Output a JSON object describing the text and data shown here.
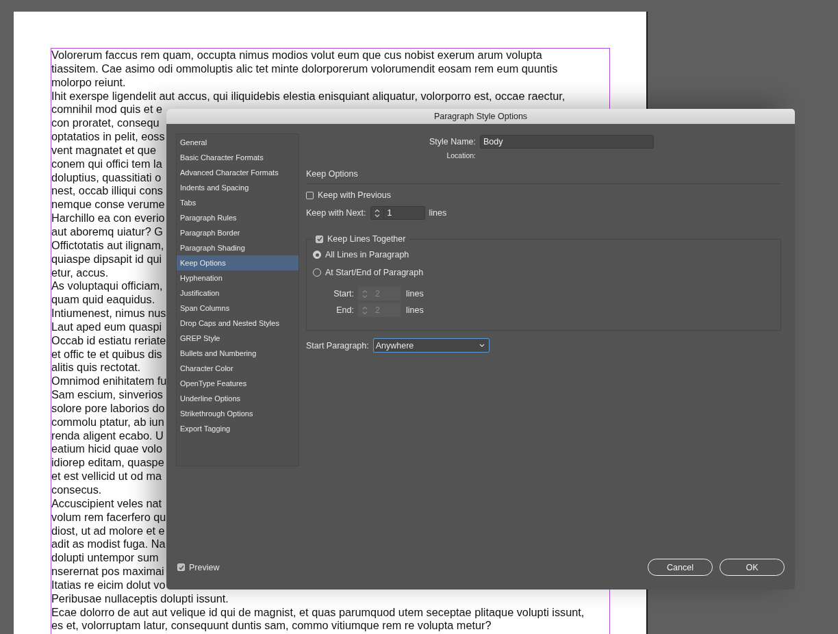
{
  "document": {
    "lines": [
      "Volorerum faccus rem quam, occupta nimus modios volut eum que cus nobist exerum arum volupta",
      "tiassitem. Cae asimo odi ommoluptis alic tet minte dolorporerum volorumendit eosam rem eum quuntis",
      "molorpo reiunt.",
      "Ihit exerspe ligendelit aut accus, qui iliquidebis elestia enisquiant aliquatur, volorporro est, occae raectur,",
      "comnihil mod quis et e",
      "con proratet, consequ",
      "optatatios in pelit, eoss",
      "vent magnatet et que",
      "conem qui offici tem la",
      "doluptius, quassitiati o",
      "nest, occab illiqui cons",
      "nemque conse verume",
      "Harchillo ea con everio",
      "aut aboremq uiatur? G",
      "Offictotatis aut ilignam,",
      "quiaspe dipsapit id qui",
      "etur, accus.",
      "As voluptaqui officiam,",
      "quam quid eaquidus.",
      "Intiumenest, nimus nus",
      "Laut aped eum quaspi",
      "Occab id estiatu reriate",
      "et offic te et quibus dis",
      "alitis quis rectotat.",
      "Omnimod enihitatem fu",
      "Sam escium, sinverios",
      "solore pore laborios do",
      "commolu ptatur, ab iun",
      "renda aligent ecabo. U",
      "eatium hicid quae volo",
      "idiorep editam, quaspe",
      "et est vellicid ut od ma",
      "consecus.",
      "Accuscipient veles nat",
      "volum rem facerfero qu",
      "diost, ut ad molore et e",
      "adit as modist fuga. Na",
      "dolupti untempor sum",
      "nserernat pos maximai",
      "Itatias re eicim dolut vo",
      "Peribusae nullaceptis dolupti issunt.",
      "Ecae dolorro de aut aut velique id qui de magnist, et quas parumquod utem seceptae plitaque volupti issunt,",
      "es et, volorruptam latur, consequunt duntis sam, commo vitiumque rem re volupta metur?"
    ]
  },
  "dialog": {
    "title": "Paragraph Style Options",
    "sidebar": {
      "items": [
        {
          "label": "General",
          "selected": false
        },
        {
          "label": "Basic Character Formats",
          "selected": false
        },
        {
          "label": "Advanced Character Formats",
          "selected": false
        },
        {
          "label": "Indents and Spacing",
          "selected": false
        },
        {
          "label": "Tabs",
          "selected": false
        },
        {
          "label": "Paragraph Rules",
          "selected": false
        },
        {
          "label": "Paragraph Border",
          "selected": false
        },
        {
          "label": "Paragraph Shading",
          "selected": false
        },
        {
          "label": "Keep Options",
          "selected": true
        },
        {
          "label": "Hyphenation",
          "selected": false
        },
        {
          "label": "Justification",
          "selected": false
        },
        {
          "label": "Span Columns",
          "selected": false
        },
        {
          "label": "Drop Caps and Nested Styles",
          "selected": false
        },
        {
          "label": "GREP Style",
          "selected": false
        },
        {
          "label": "Bullets and Numbering",
          "selected": false
        },
        {
          "label": "Character Color",
          "selected": false
        },
        {
          "label": "OpenType Features",
          "selected": false
        },
        {
          "label": "Underline Options",
          "selected": false
        },
        {
          "label": "Strikethrough Options",
          "selected": false
        },
        {
          "label": "Export Tagging",
          "selected": false
        }
      ]
    },
    "style_name": {
      "label": "Style Name:",
      "value": "Body"
    },
    "location": {
      "label": "Location:"
    },
    "section_title": "Keep Options",
    "keep_with_previous": {
      "label": "Keep with Previous",
      "checked": false
    },
    "keep_with_next": {
      "label": "Keep with Next:",
      "value": "1",
      "unit": "lines"
    },
    "keep_lines_together": {
      "label": "Keep Lines Together",
      "checked": true,
      "options": [
        {
          "label": "All Lines in Paragraph",
          "selected": true
        },
        {
          "label": "At Start/End of Paragraph",
          "selected": false
        }
      ],
      "fields": [
        {
          "label": "Start:",
          "value": "2",
          "unit": "lines",
          "disabled": true
        },
        {
          "label": "End:",
          "value": "2",
          "unit": "lines",
          "disabled": true
        }
      ]
    },
    "start_paragraph": {
      "label": "Start Paragraph:",
      "value": "Anywhere"
    },
    "preview": {
      "label": "Preview",
      "checked": true
    },
    "buttons": [
      {
        "label": "Cancel"
      },
      {
        "label": "OK"
      }
    ]
  }
}
